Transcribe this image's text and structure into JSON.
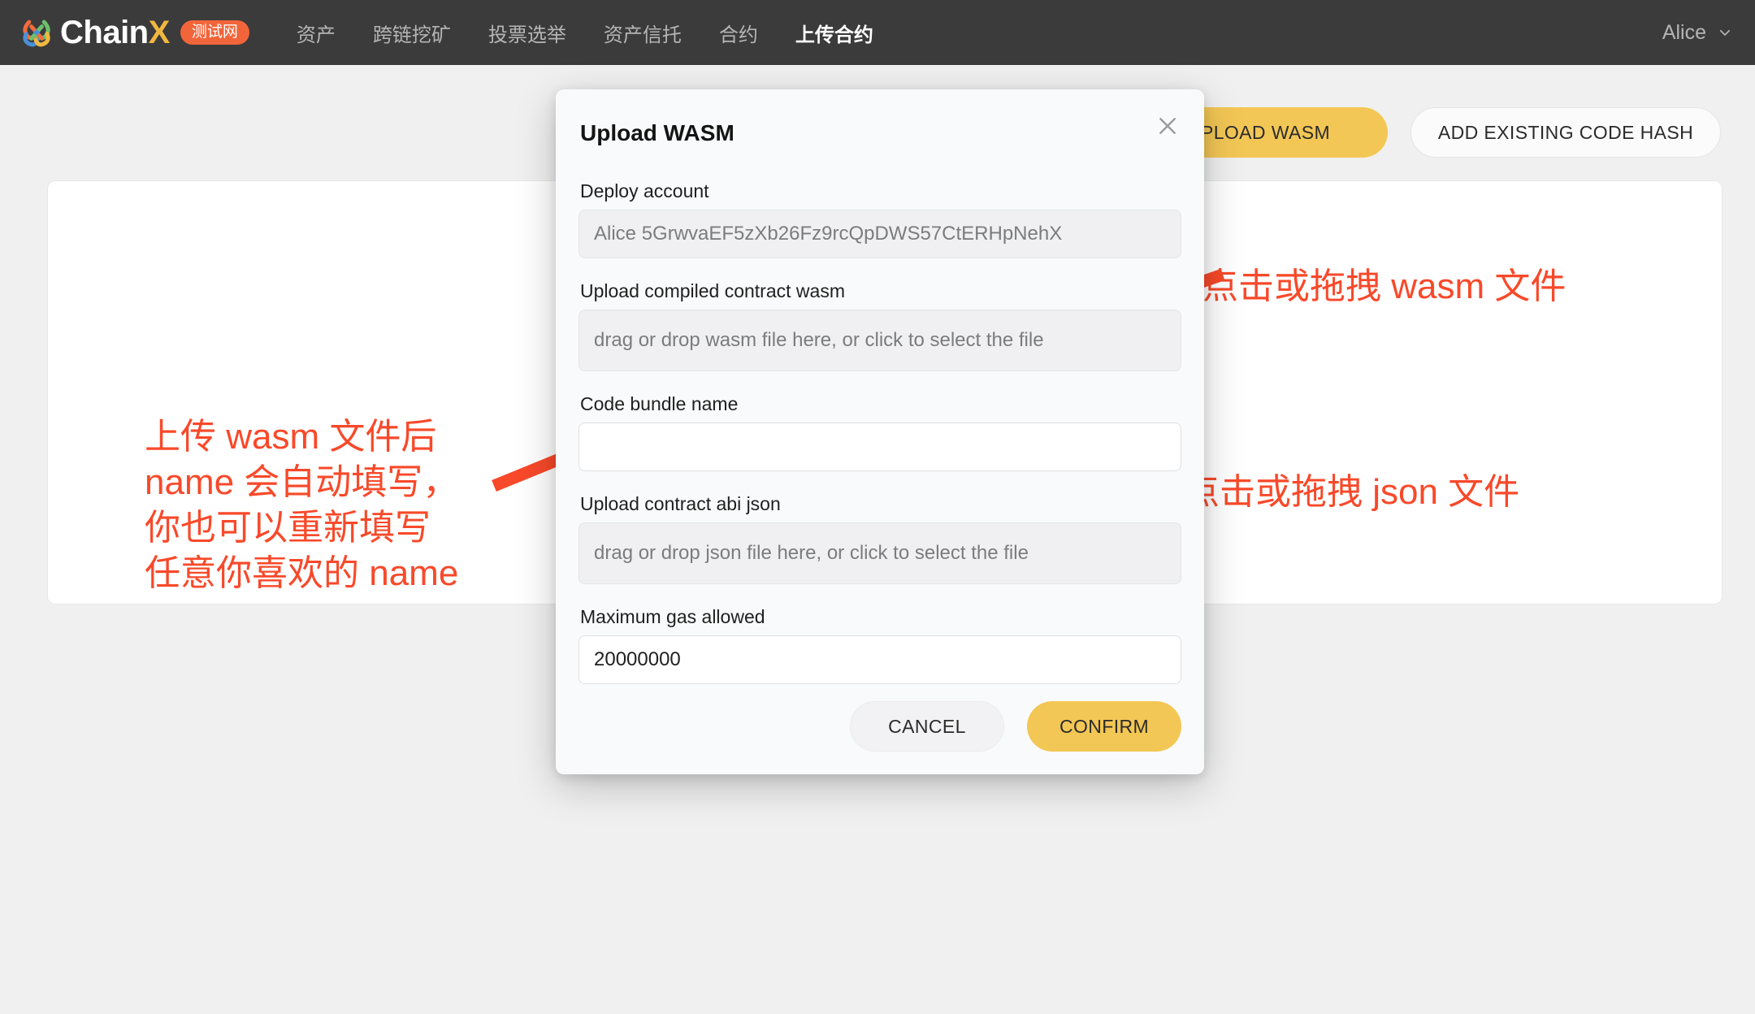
{
  "navbar": {
    "brand_name": "ChainX",
    "brand_badge": "测试网",
    "links": [
      {
        "label": "资产",
        "active": false
      },
      {
        "label": "跨链挖矿",
        "active": false
      },
      {
        "label": "投票选举",
        "active": false
      },
      {
        "label": "资产信托",
        "active": false
      },
      {
        "label": "合约",
        "active": false
      },
      {
        "label": "上传合约",
        "active": true
      }
    ],
    "user": "Alice",
    "chevron_icon": "chevron-down-icon",
    "background_color": "#3b3b3b"
  },
  "toolbar": {
    "upload_wasm_label": "UPLOAD WASM",
    "add_existing_code_hash_label": "ADD EXISTING CODE HASH",
    "accent_color": "#f3c755"
  },
  "dialog": {
    "title": "Upload WASM",
    "close_icon": "close-icon",
    "fields": {
      "deploy_account": {
        "label": "Deploy account",
        "value": "Alice 5GrwvaEF5zXb26Fz9rcQpDWS57CtERHpNehX"
      },
      "upload_wasm": {
        "label": "Upload compiled contract wasm",
        "placeholder": "drag or drop wasm file here, or click to select the file"
      },
      "code_bundle_name": {
        "label": "Code bundle name",
        "value": "",
        "placeholder": ""
      },
      "upload_abi_json": {
        "label": "Upload contract abi json",
        "placeholder": "drag or drop json file here, or click to select the file"
      },
      "max_gas": {
        "label": "Maximum gas allowed",
        "value": "20000000"
      }
    },
    "cancel_label": "CANCEL",
    "confirm_label": "CONFIRM"
  },
  "annotations": {
    "color": "#f8492a",
    "left_note": "上传 wasm 文件后\nname 会自动填写，\n你也可以重新填写\n任意你喜欢的 name",
    "wasm_note": "点击或拖拽 wasm 文件",
    "json_note": "点击或拖拽 json 文件"
  }
}
